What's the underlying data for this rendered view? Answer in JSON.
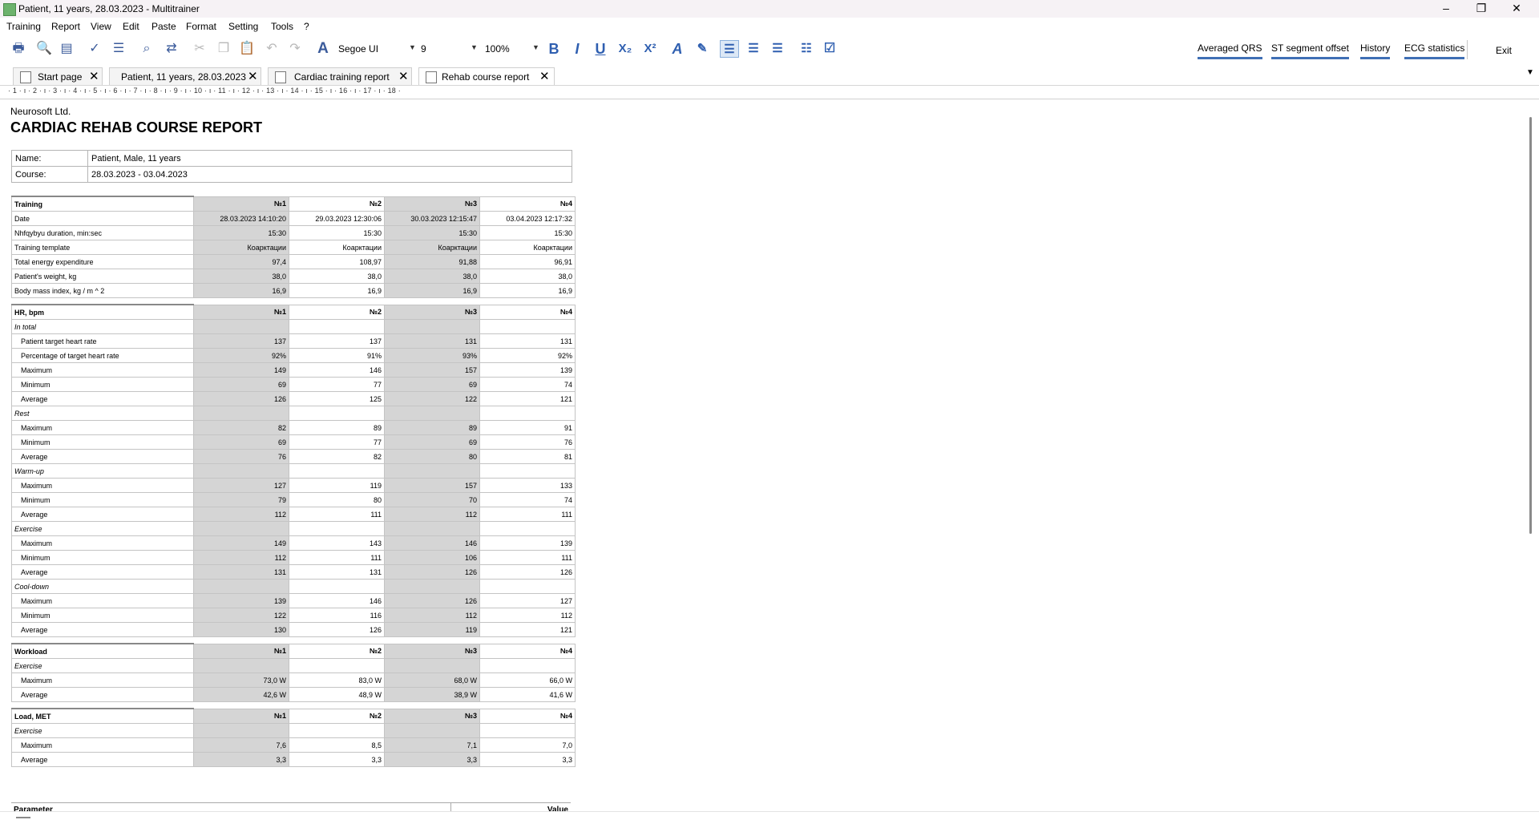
{
  "window": {
    "title": "Patient, 11 years, 28.03.2023 - Multitrainer",
    "minimize_glyph": "–",
    "maximize_glyph": "❐",
    "close_glyph": "✕"
  },
  "menu": [
    "Training",
    "Report",
    "View",
    "Edit",
    "Paste",
    "Format",
    "Setting",
    "Tools",
    "?"
  ],
  "toolbar": {
    "font_name": "Segoe UI",
    "font_size": "9",
    "zoom": "100%",
    "format": {
      "bold": "B",
      "italic": "I",
      "underline": "U",
      "subscript": "X₂",
      "superscript": "X²",
      "font_color": "A",
      "highlight": "✎"
    },
    "right_links": [
      "Averaged QRS",
      "ST segment offset",
      "History",
      "ECG statistics"
    ],
    "exit_label": "Exit",
    "accent_color": "#3f6fb5"
  },
  "tabs": [
    {
      "label": "Start page",
      "active": false,
      "close": "✕"
    },
    {
      "label": "Patient, 11 years, 28.03.2023",
      "active": false,
      "close": "✕"
    },
    {
      "label": "Cardiac training report",
      "active": false,
      "close": "✕"
    },
    {
      "label": "Rehab course report",
      "active": true,
      "close": "✕"
    }
  ],
  "ruler": {
    "text": "· 1 · ı · 2 · ı · 3 · ı · 4 · ı · 5 · ı · 6 · ı · 7 · ı · 8 · ı · 9 · ı · 10 · ı · 11 · ı · 12 · ı · 13 · ı · 14 · ı · 15 · ı · 16 · ı · 17 · ı · 18 ·"
  },
  "report": {
    "company": "Neurosoft Ltd.",
    "title": "CARDIAC REHAB COURSE REPORT",
    "info": [
      {
        "label": "Name:",
        "value": "Patient, Male, 11 years"
      },
      {
        "label": "Course:",
        "value": "28.03.2023 - 03.04.2023"
      }
    ],
    "training": {
      "header": [
        "Training",
        "№1",
        "№2",
        "№3",
        "№4"
      ],
      "rows": [
        {
          "label": "Date",
          "values": [
            "28.03.2023 14:10:20",
            "29.03.2023 12:30:06",
            "30.03.2023 12:15:47",
            "03.04.2023 12:17:32"
          ]
        },
        {
          "label": "Nhfqybyu duration, min:sec",
          "values": [
            "15:30",
            "15:30",
            "15:30",
            "15:30"
          ]
        },
        {
          "label": "Training template",
          "values": [
            "Коарктации",
            "Коарктации",
            "Коарктации",
            "Коарктации"
          ]
        },
        {
          "label": "Total energy expenditure",
          "values": [
            "97,4",
            "108,97",
            "91,88",
            "96,91"
          ]
        },
        {
          "label": "Patient's weight, kg",
          "values": [
            "38,0",
            "38,0",
            "38,0",
            "38,0"
          ]
        },
        {
          "label": "Body mass index, kg / m ^ 2",
          "values": [
            "16,9",
            "16,9",
            "16,9",
            "16,9"
          ]
        }
      ]
    },
    "hr": {
      "header": [
        "HR, bpm",
        "№1",
        "№2",
        "№3",
        "№4"
      ],
      "groups": [
        {
          "name": "In total",
          "rows": [
            {
              "label": "Patient target heart rate",
              "values": [
                "137",
                "137",
                "131",
                "131"
              ]
            },
            {
              "label": "Percentage of target heart rate",
              "values": [
                "92%",
                "91%",
                "93%",
                "92%"
              ]
            },
            {
              "label": "Maximum",
              "values": [
                "149",
                "146",
                "157",
                "139"
              ]
            },
            {
              "label": "Minimum",
              "values": [
                "69",
                "77",
                "69",
                "74"
              ]
            },
            {
              "label": "Average",
              "values": [
                "126",
                "125",
                "122",
                "121"
              ]
            }
          ]
        },
        {
          "name": "Rest",
          "rows": [
            {
              "label": "Maximum",
              "values": [
                "82",
                "89",
                "89",
                "91"
              ]
            },
            {
              "label": "Minimum",
              "values": [
                "69",
                "77",
                "69",
                "76"
              ]
            },
            {
              "label": "Average",
              "values": [
                "76",
                "82",
                "80",
                "81"
              ]
            }
          ]
        },
        {
          "name": "Warm-up",
          "rows": [
            {
              "label": "Maximum",
              "values": [
                "127",
                "119",
                "157",
                "133"
              ]
            },
            {
              "label": "Minimum",
              "values": [
                "79",
                "80",
                "70",
                "74"
              ]
            },
            {
              "label": "Average",
              "values": [
                "112",
                "111",
                "112",
                "111"
              ]
            }
          ]
        },
        {
          "name": "Exercise",
          "rows": [
            {
              "label": "Maximum",
              "values": [
                "149",
                "143",
                "146",
                "139"
              ]
            },
            {
              "label": "Minimum",
              "values": [
                "112",
                "111",
                "106",
                "111"
              ]
            },
            {
              "label": "Average",
              "values": [
                "131",
                "131",
                "126",
                "126"
              ]
            }
          ]
        },
        {
          "name": "Cool-down",
          "rows": [
            {
              "label": "Maximum",
              "values": [
                "139",
                "146",
                "126",
                "127"
              ]
            },
            {
              "label": "Minimum",
              "values": [
                "122",
                "116",
                "112",
                "112"
              ]
            },
            {
              "label": "Average",
              "values": [
                "130",
                "126",
                "119",
                "121"
              ]
            }
          ]
        }
      ]
    },
    "workload": {
      "header": [
        "Workload",
        "№1",
        "№2",
        "№3",
        "№4"
      ],
      "group": "Exercise",
      "rows": [
        {
          "label": "Maximum",
          "values": [
            "73,0 W",
            "83,0 W",
            "68,0 W",
            "66,0 W"
          ]
        },
        {
          "label": "Average",
          "values": [
            "42,6 W",
            "48,9 W",
            "38,9 W",
            "41,6 W"
          ]
        }
      ]
    },
    "met": {
      "header": [
        "Load, MET",
        "№1",
        "№2",
        "№3",
        "№4"
      ],
      "group": "Exercise",
      "rows": [
        {
          "label": "Maximum",
          "values": [
            "7,6",
            "8,5",
            "7,1",
            "7,0"
          ]
        },
        {
          "label": "Average",
          "values": [
            "3,3",
            "3,3",
            "3,3",
            "3,3"
          ]
        }
      ]
    },
    "parameter": {
      "label": "Parameter",
      "value": "Value"
    }
  }
}
